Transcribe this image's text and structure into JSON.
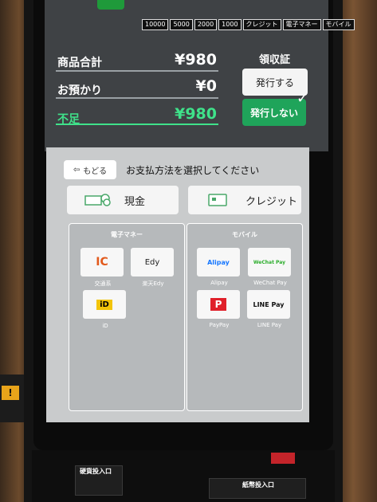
{
  "banknotes": [
    "10000",
    "5000",
    "2000",
    "1000",
    "クレジット",
    "電子マネー",
    "モバイル"
  ],
  "summary": {
    "total_label": "商品合計",
    "total_value": "¥980",
    "deposit_label": "お預かり",
    "deposit_value": "¥0",
    "shortfall_label": "不足",
    "shortfall_value": "¥980"
  },
  "receipt": {
    "title": "領収証",
    "issue": "発行する",
    "no_issue": "発行しない"
  },
  "payment": {
    "back": "もどる",
    "instruction": "お支払方法を選択してください",
    "cash": "現金",
    "credit": "クレジット"
  },
  "emoney": {
    "title": "電子マネー",
    "items": [
      {
        "label": "交通系",
        "logo": "IC"
      },
      {
        "label": "楽天Edy",
        "logo": "Edy"
      },
      {
        "label": "iD",
        "logo": "iD"
      }
    ]
  },
  "mobile": {
    "title": "モバイル",
    "items": [
      {
        "label": "Alipay",
        "logo": "Alipay"
      },
      {
        "label": "WeChat Pay",
        "logo": "WeChat Pay"
      },
      {
        "label": "PayPay",
        "logo": "P"
      },
      {
        "label": "LINE Pay",
        "logo": "LINE Pay"
      }
    ]
  },
  "hardware": {
    "coin_label": "硬貨投入口",
    "bill_label": "紙幣投入口"
  }
}
